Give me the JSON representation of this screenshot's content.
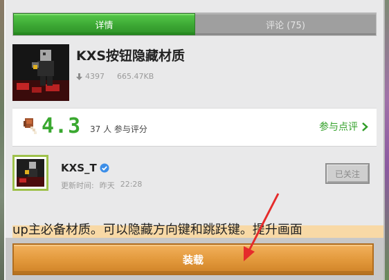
{
  "tabs": [
    {
      "label": "详情",
      "active": true
    },
    {
      "label": "评论 (75)",
      "active": false
    }
  ],
  "resource": {
    "title": "KXS按钮隐藏材质",
    "downloads": "4397",
    "size": "665.47KB"
  },
  "rating": {
    "score": "4.3",
    "count_text": "37 人 参与评分",
    "review_link": "参与点评"
  },
  "author": {
    "name": "KXS_T",
    "verified": true,
    "updated_label": "更新时间:",
    "updated_day": "昨天",
    "updated_time": "22:28",
    "follow_label": "已关注"
  },
  "description": "up主必备材质。可以隐藏方向键和跳跃键。提升画面",
  "install_label": "装载",
  "colors": {
    "accent_green": "#3ca834",
    "install_orange": "#e39a3d",
    "annotation_red": "#e52b2b"
  },
  "icons": {
    "download": "download-arrow-icon",
    "rating": "drumstick-icon",
    "chevron": "chevron-right-icon",
    "verified": "verified-badge-icon"
  }
}
